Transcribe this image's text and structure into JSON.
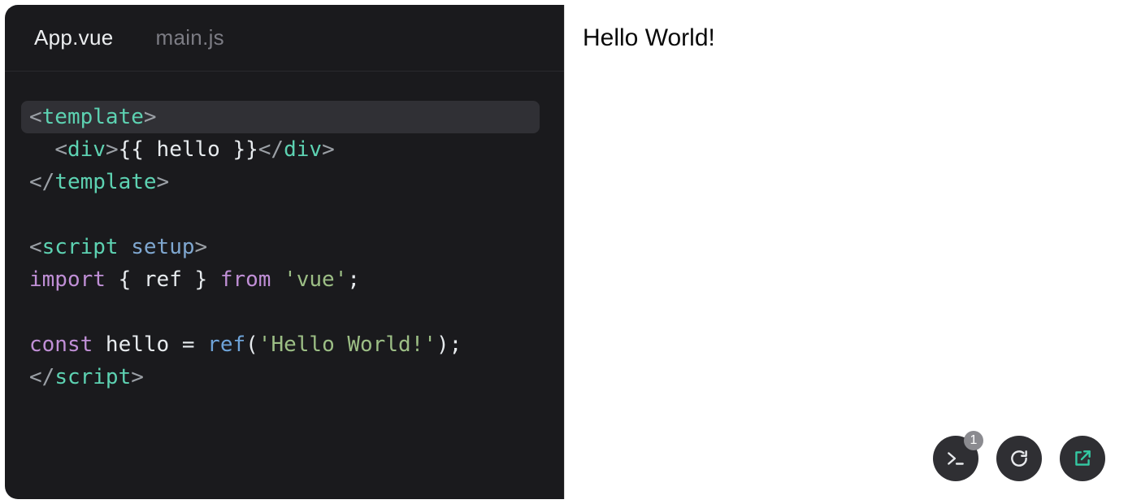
{
  "tabs": {
    "items": [
      {
        "label": "App.vue",
        "active": true
      },
      {
        "label": "main.js",
        "active": false
      }
    ]
  },
  "code": {
    "lines": [
      {
        "hl": true,
        "tokens": [
          [
            "c-angle",
            "<"
          ],
          [
            "c-tag",
            "template"
          ],
          [
            "c-angle",
            ">"
          ]
        ]
      },
      {
        "hl": false,
        "tokens": [
          [
            "c-plain",
            "  "
          ],
          [
            "c-angle",
            "<"
          ],
          [
            "c-tag",
            "div"
          ],
          [
            "c-angle",
            ">"
          ],
          [
            "c-plain",
            "{{ hello }}"
          ],
          [
            "c-angle",
            "</"
          ],
          [
            "c-tag",
            "div"
          ],
          [
            "c-angle",
            ">"
          ]
        ]
      },
      {
        "hl": false,
        "tokens": [
          [
            "c-angle",
            "</"
          ],
          [
            "c-tag",
            "template"
          ],
          [
            "c-angle",
            ">"
          ]
        ]
      },
      {
        "hl": false,
        "tokens": [
          [
            "c-plain",
            ""
          ]
        ]
      },
      {
        "hl": false,
        "tokens": [
          [
            "c-angle",
            "<"
          ],
          [
            "c-tag",
            "script"
          ],
          [
            "c-plain",
            " "
          ],
          [
            "c-attr",
            "setup"
          ],
          [
            "c-angle",
            ">"
          ]
        ]
      },
      {
        "hl": false,
        "tokens": [
          [
            "c-key",
            "import"
          ],
          [
            "c-plain",
            " { ref } "
          ],
          [
            "c-key",
            "from"
          ],
          [
            "c-plain",
            " "
          ],
          [
            "c-str",
            "'vue'"
          ],
          [
            "c-plain",
            ";"
          ]
        ]
      },
      {
        "hl": false,
        "tokens": [
          [
            "c-plain",
            ""
          ]
        ]
      },
      {
        "hl": false,
        "tokens": [
          [
            "c-key",
            "const"
          ],
          [
            "c-plain",
            " hello = "
          ],
          [
            "c-func",
            "ref"
          ],
          [
            "c-plain",
            "("
          ],
          [
            "c-str",
            "'Hello World!'"
          ],
          [
            "c-plain",
            ");"
          ]
        ]
      },
      {
        "hl": false,
        "tokens": [
          [
            "c-angle",
            "</"
          ],
          [
            "c-tag",
            "script"
          ],
          [
            "c-angle",
            ">"
          ]
        ]
      }
    ]
  },
  "preview": {
    "output": "Hello World!"
  },
  "controls": {
    "console_badge": "1"
  }
}
